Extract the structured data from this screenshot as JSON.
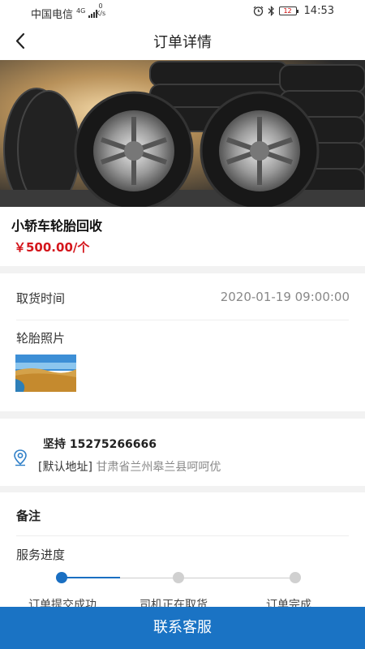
{
  "status_bar": {
    "carrier": "中国电信",
    "network": "4G",
    "speed_value": "0",
    "speed_unit": "K/s",
    "battery": "12",
    "time": "14:53"
  },
  "nav": {
    "title": "订单详情"
  },
  "product": {
    "name": "小轿车轮胎回收",
    "price": "￥500.00/个"
  },
  "pickup": {
    "label": "取货时间",
    "value": "2020-01-19 09:00:00"
  },
  "photos": {
    "label": "轮胎照片"
  },
  "address": {
    "contact": "坚持 15275266666",
    "tag": "[默认地址]",
    "text": "甘肃省兰州皋兰县呵呵优"
  },
  "remark": {
    "label": "备注"
  },
  "progress": {
    "label": "服务进度",
    "current_step": 1,
    "steps": [
      "订单提交成功",
      "司机正在取货",
      "订单完成"
    ]
  },
  "footer": {
    "contact_label": "联系客服"
  },
  "colors": {
    "accent": "#1a73c4",
    "price": "#d4161c"
  }
}
